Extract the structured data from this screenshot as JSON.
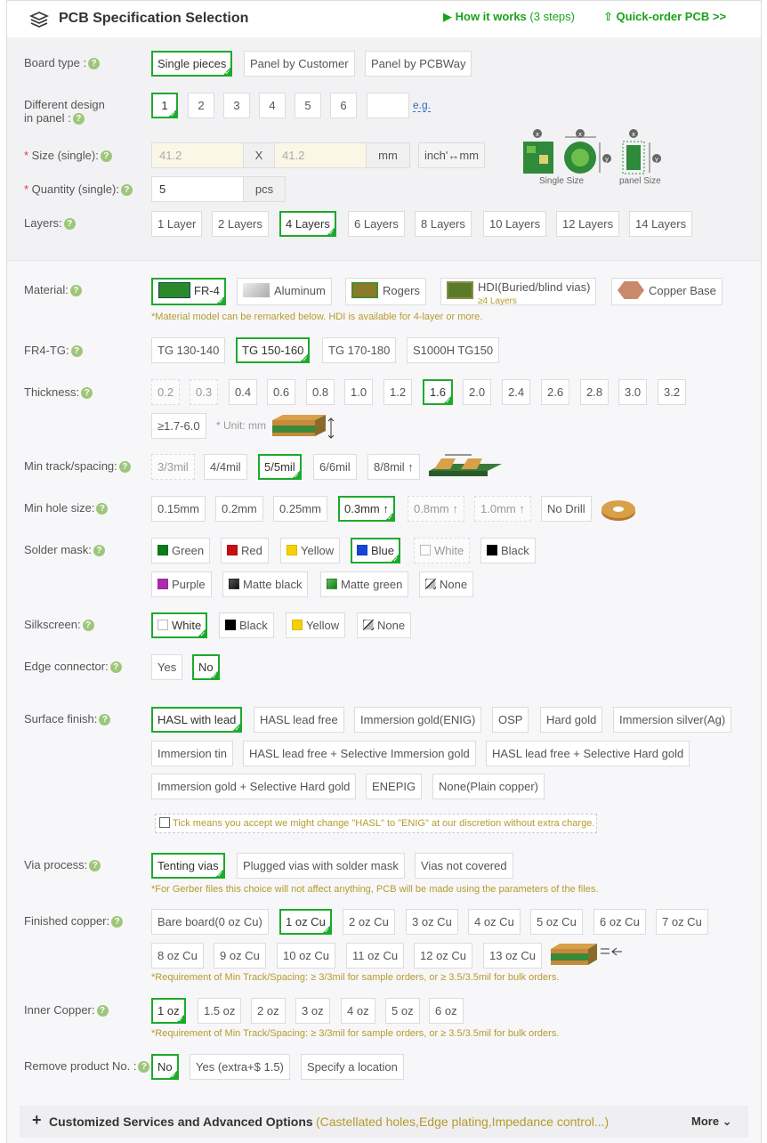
{
  "header": {
    "title": "PCB Specification Selection",
    "how_it_works": "How it works",
    "steps": "(3 steps)",
    "quick_order": "Quick-order PCB >>"
  },
  "board_type": {
    "label": "Board type :",
    "options": [
      "Single pieces",
      "Panel by Customer",
      "Panel by PCBWay"
    ],
    "selected": "Single pieces"
  },
  "design": {
    "label_1": "Different design",
    "label_2": "in panel :",
    "options": [
      "1",
      "2",
      "3",
      "4",
      "5",
      "6"
    ],
    "selected": "1",
    "eg": "e.g."
  },
  "size": {
    "label": "Size (single):",
    "width": "41.2",
    "x": "X",
    "height": "41.2",
    "unit": "mm",
    "toggle": "inch'↔mm",
    "single_caption": "Single Size",
    "panel_caption": "panel Size"
  },
  "quantity": {
    "label": "Quantity (single):",
    "value": "5",
    "unit": "pcs"
  },
  "layers": {
    "label": "Layers:",
    "options": [
      "1 Layer",
      "2 Layers",
      "4 Layers",
      "6 Layers",
      "8 Layers",
      "10 Layers",
      "12 Layers",
      "14 Layers"
    ],
    "selected": "4 Layers"
  },
  "material": {
    "label": "Material:",
    "options": [
      "FR-4",
      "Aluminum",
      "Rogers",
      "HDI(Buried/blind vias)",
      "Copper Base"
    ],
    "hdi_sub": "≥4 Layers",
    "selected": "FR-4",
    "note": "*Material model can be remarked below. HDI is available for 4-layer or more."
  },
  "tg": {
    "label": "FR4-TG:",
    "options": [
      "TG 130-140",
      "TG 150-160",
      "TG 170-180",
      "S1000H TG150"
    ],
    "selected": "TG 150-160"
  },
  "thickness": {
    "label": "Thickness:",
    "options": [
      "0.2",
      "0.3",
      "0.4",
      "0.6",
      "0.8",
      "1.0",
      "1.2",
      "1.6",
      "2.0",
      "2.4",
      "2.6",
      "2.8",
      "3.0",
      "3.2",
      "≥1.7-6.0"
    ],
    "selected": "1.6",
    "unit_note": "* Unit: mm"
  },
  "track": {
    "label": "Min track/spacing:",
    "options": [
      "3/3mil",
      "4/4mil",
      "5/5mil",
      "6/6mil",
      "8/8mil ↑"
    ],
    "selected": "5/5mil"
  },
  "hole": {
    "label": "Min hole size:",
    "options": [
      "0.15mm",
      "0.2mm",
      "0.25mm",
      "0.3mm ↑",
      "0.8mm ↑",
      "1.0mm ↑",
      "No Drill"
    ],
    "selected": "0.3mm ↑"
  },
  "solder_mask": {
    "label": "Solder mask:",
    "options": [
      "Green",
      "Red",
      "Yellow",
      "Blue",
      "White",
      "Black",
      "Purple",
      "Matte black",
      "Matte green",
      "None"
    ],
    "colors": [
      "#0a7a1a",
      "#c41010",
      "#f5d000",
      "#1644d8",
      "#ffffff",
      "#000000",
      "#b02ab0",
      "#222222",
      "#2d9a2d",
      "none"
    ],
    "selected": "Blue"
  },
  "silkscreen": {
    "label": "Silkscreen:",
    "options": [
      "White",
      "Black",
      "Yellow",
      "None"
    ],
    "colors": [
      "#ffffff",
      "#000000",
      "#f5d000",
      "none"
    ],
    "selected": "White"
  },
  "edge": {
    "label": "Edge connector:",
    "options": [
      "Yes",
      "No"
    ],
    "selected": "No"
  },
  "surface": {
    "label": "Surface finish:",
    "options": [
      "HASL with lead",
      "HASL lead free",
      "Immersion gold(ENIG)",
      "OSP",
      "Hard gold",
      "Immersion silver(Ag)",
      "Immersion tin",
      "HASL lead free + Selective Immersion gold",
      "HASL lead free + Selective Hard gold",
      "Immersion gold + Selective Hard gold",
      "ENEPIG",
      "None(Plain copper)"
    ],
    "selected": "HASL with lead",
    "tick_note": "Tick means you accept we might change \"HASL\" to \"ENIG\" at our discretion without extra charge."
  },
  "via": {
    "label": "Via process:",
    "options": [
      "Tenting vias",
      "Plugged vias with solder mask",
      "Vias not covered"
    ],
    "selected": "Tenting vias",
    "note": "*For Gerber files this choice will not affect anything, PCB will be made using the parameters of the files."
  },
  "copper": {
    "label": "Finished copper:",
    "options": [
      "Bare board(0 oz Cu)",
      "1 oz Cu",
      "2 oz Cu",
      "3 oz Cu",
      "4 oz Cu",
      "5 oz Cu",
      "6 oz Cu",
      "7 oz Cu",
      "8 oz Cu",
      "9 oz Cu",
      "10 oz Cu",
      "11 oz Cu",
      "12 oz Cu",
      "13 oz Cu"
    ],
    "selected": "1 oz Cu",
    "note": "*Requirement of Min Track/Spacing: ≥ 3/3mil for sample orders, or ≥ 3.5/3.5mil for bulk orders."
  },
  "inner": {
    "label": "Inner Copper:",
    "options": [
      "1 oz",
      "1.5 oz",
      "2 oz",
      "3 oz",
      "4 oz",
      "5 oz",
      "6 oz"
    ],
    "selected": "1 oz",
    "note": "*Requirement of Min Track/Spacing: ≥ 3/3mil for sample orders, or ≥ 3.5/3.5mil for bulk orders."
  },
  "remove": {
    "label": "Remove product No. :",
    "options": [
      "No",
      "Yes (extra+$ 1.5)",
      "Specify a location"
    ],
    "selected": "No"
  },
  "more": {
    "title": "Customized Services and Advanced Options",
    "sub": "(Castellated holes,Edge plating,Impedance control...)",
    "more": "More"
  },
  "colors": {
    "accent": "#1caa2c",
    "note": "#b59b2c",
    "link": "#2a6ebb"
  }
}
